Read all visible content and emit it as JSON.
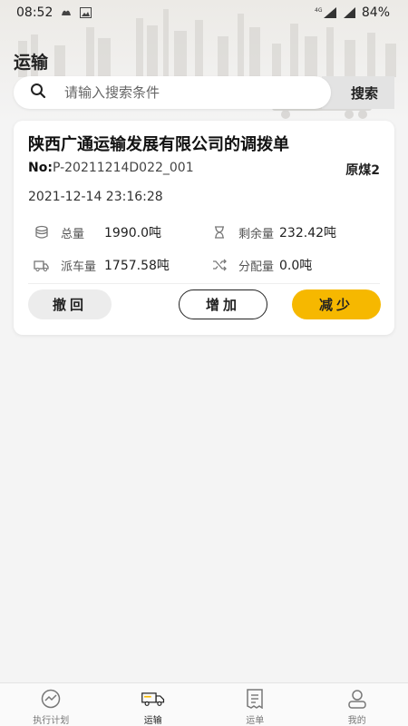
{
  "status_bar": {
    "time": "08:52",
    "battery": "84%",
    "network": "4G"
  },
  "header": {
    "title": "运输"
  },
  "search": {
    "placeholder": "请输入搜索条件",
    "button_label": "搜索"
  },
  "card": {
    "title": "陕西广通运输发展有限公司的调拨单",
    "no_label": "No:",
    "no_value": "P-20211214D022_001",
    "cargo": "原煤2",
    "datetime": "2021-12-14 23:16:28",
    "stats": [
      {
        "label": "总量",
        "value": "1990.0吨",
        "icon": "stack-icon"
      },
      {
        "label": "剩余量",
        "value": "232.42吨",
        "icon": "hourglass-icon"
      },
      {
        "label": "派车量",
        "value": "1757.58吨",
        "icon": "truck-icon"
      },
      {
        "label": "分配量",
        "value": "0.0吨",
        "icon": "shuffle-icon"
      }
    ],
    "buttons": {
      "revoke": "撤回",
      "add": "增加",
      "reduce": "减少"
    }
  },
  "tabbar": {
    "items": [
      {
        "label": "执行计划",
        "icon": "chart-circle-icon"
      },
      {
        "label": "运输",
        "icon": "truck-icon"
      },
      {
        "label": "运单",
        "icon": "receipt-icon"
      },
      {
        "label": "我的",
        "icon": "user-icon"
      }
    ],
    "active_index": 1
  },
  "colors": {
    "accent": "#f6b800",
    "background": "#f4f4f4"
  }
}
